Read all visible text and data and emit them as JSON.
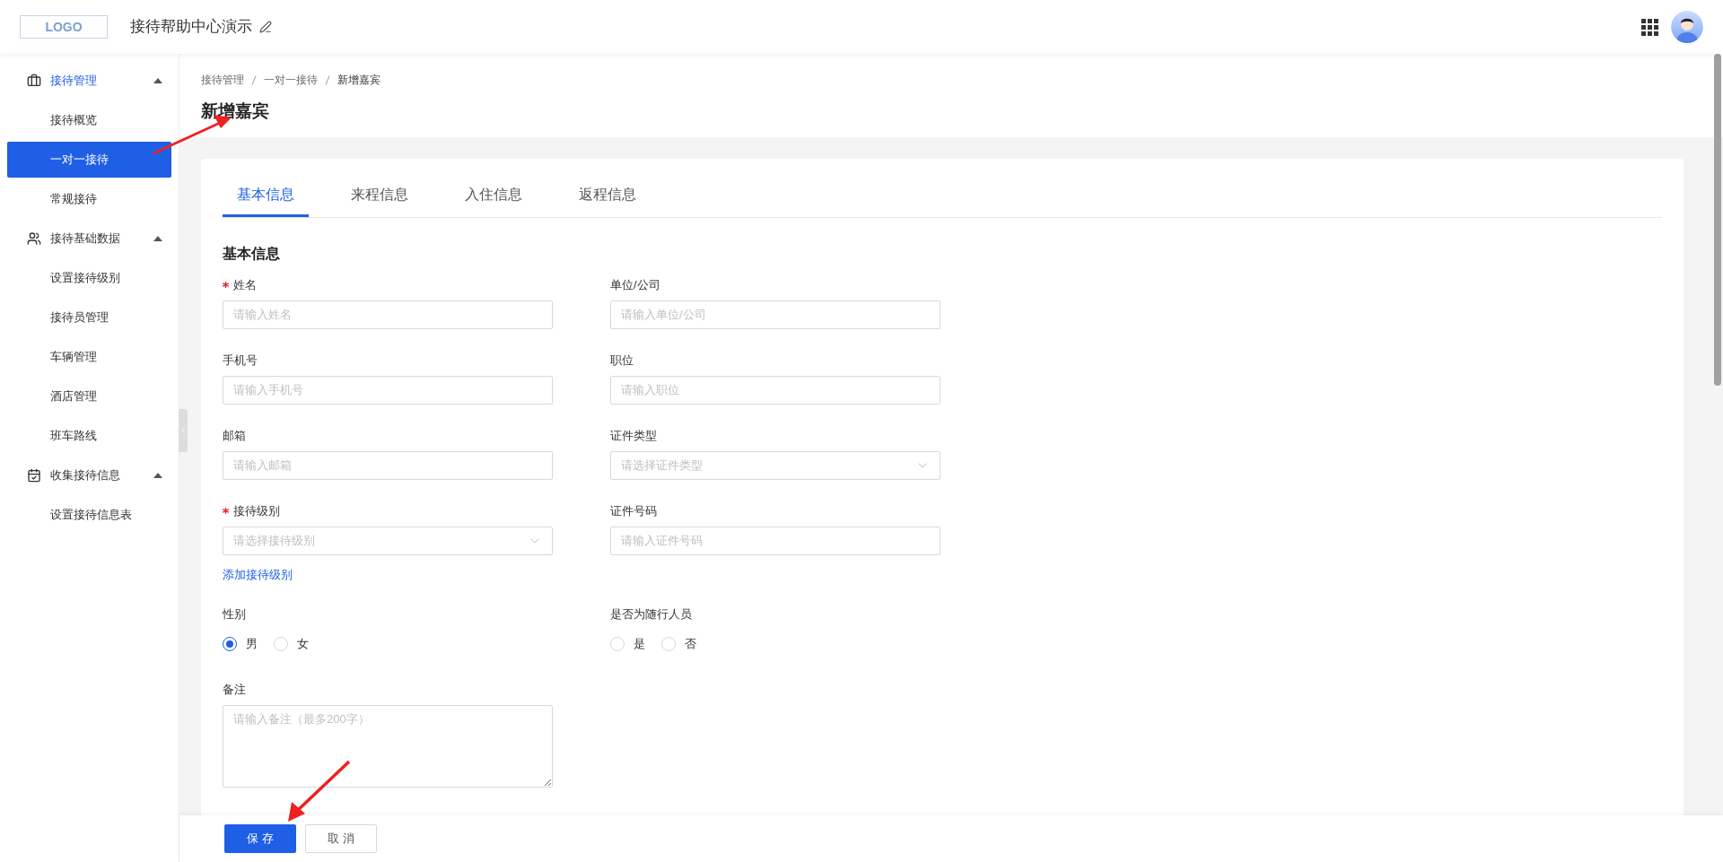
{
  "header": {
    "logo": "LOGO",
    "app_title": "接待帮助中心演示"
  },
  "sidebar": {
    "groups": [
      {
        "label": "接待管理",
        "kind": "briefcase",
        "active": true,
        "expanded": true,
        "children": [
          {
            "label": "接待概览",
            "selected": false
          },
          {
            "label": "一对一接待",
            "selected": true
          },
          {
            "label": "常规接待",
            "selected": false
          }
        ]
      },
      {
        "label": "接待基础数据",
        "kind": "users",
        "active": false,
        "expanded": true,
        "children": [
          {
            "label": "设置接待级别",
            "selected": false
          },
          {
            "label": "接待员管理",
            "selected": false
          },
          {
            "label": "车辆管理",
            "selected": false
          },
          {
            "label": "酒店管理",
            "selected": false
          },
          {
            "label": "班车路线",
            "selected": false
          }
        ]
      },
      {
        "label": "收集接待信息",
        "kind": "calendar",
        "active": false,
        "expanded": true,
        "children": [
          {
            "label": "设置接待信息表",
            "selected": false
          }
        ]
      }
    ]
  },
  "breadcrumb": [
    "接待管理",
    "一对一接待",
    "新增嘉宾"
  ],
  "page_title": "新增嘉宾",
  "tabs": [
    {
      "label": "基本信息",
      "selected": true
    },
    {
      "label": "来程信息",
      "selected": false
    },
    {
      "label": "入住信息",
      "selected": false
    },
    {
      "label": "返程信息",
      "selected": false
    }
  ],
  "section_title": "基本信息",
  "fields": [
    {
      "label": "姓名",
      "required": true,
      "kind": "input",
      "placeholder": "请输入姓名"
    },
    {
      "label": "单位/公司",
      "required": false,
      "kind": "input",
      "placeholder": "请输入单位/公司"
    },
    {
      "label": "手机号",
      "required": false,
      "kind": "input",
      "placeholder": "请输入手机号"
    },
    {
      "label": "职位",
      "required": false,
      "kind": "input",
      "placeholder": "请输入职位"
    },
    {
      "label": "邮箱",
      "required": false,
      "kind": "input",
      "placeholder": "请输入邮箱"
    },
    {
      "label": "证件类型",
      "required": false,
      "kind": "select",
      "placeholder": "请选择证件类型"
    },
    {
      "label": "接待级别",
      "required": true,
      "kind": "select",
      "placeholder": "请选择接待级别",
      "link": "添加接待级别"
    },
    {
      "label": "证件号码",
      "required": false,
      "kind": "input",
      "placeholder": "请输入证件号码"
    },
    {
      "label": "性别",
      "required": false,
      "kind": "radio",
      "options": [
        {
          "label": "男",
          "selected": true
        },
        {
          "label": "女",
          "selected": false
        }
      ]
    },
    {
      "label": "是否为随行人员",
      "required": false,
      "kind": "radio",
      "options": [
        {
          "label": "是",
          "selected": false
        },
        {
          "label": "否",
          "selected": false
        }
      ]
    },
    {
      "label": "备注",
      "required": false,
      "kind": "textarea",
      "placeholder": "请输入备注（最多200字）"
    }
  ],
  "buttons": [
    {
      "label": "保 存",
      "kind": "primary"
    },
    {
      "label": "取 消",
      "kind": "default"
    }
  ]
}
